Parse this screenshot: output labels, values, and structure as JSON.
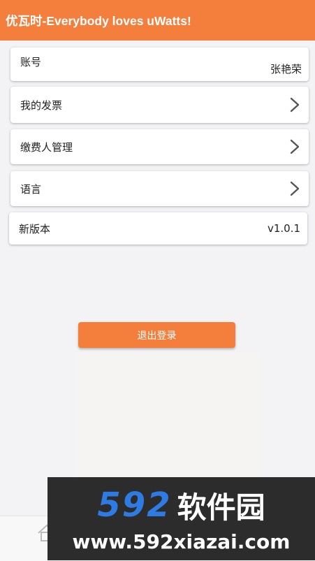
{
  "header": {
    "title": "优瓦时-Everybody loves uWatts!"
  },
  "menu": {
    "account": {
      "label": "账号",
      "value": "张艳荣"
    },
    "invoices": {
      "label": "我的发票"
    },
    "payers": {
      "label": "缴费人管理"
    },
    "language": {
      "label": "语言"
    },
    "version": {
      "label": "新版本",
      "value": "v1.0.1"
    }
  },
  "logout_button": {
    "label": "退出登录"
  },
  "watermark": {
    "brand_digits": "592",
    "brand_cn": "软件园",
    "url": "www.592xiazai.com"
  },
  "colors": {
    "accent": "#f47e3c",
    "watermark_blue": "#2e7be3",
    "watermark_bg": "#2c2c2c"
  },
  "icons": {
    "chevron": "chevron-right-icon",
    "home": "home-icon"
  }
}
